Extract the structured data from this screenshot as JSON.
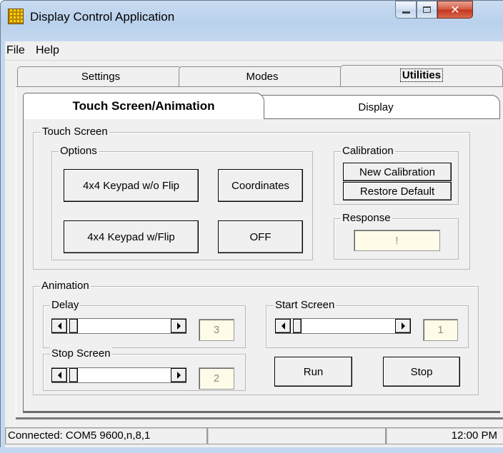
{
  "window": {
    "title": "Display Control Application",
    "icon": "keypad-grid-icon"
  },
  "menu": [
    "File",
    "Help"
  ],
  "outer_tabs": [
    {
      "label": "Settings",
      "active": false
    },
    {
      "label": "Modes",
      "active": false
    },
    {
      "label": "Utilities",
      "active": true
    }
  ],
  "inner_tabs": [
    {
      "label": "Touch Screen/Animation",
      "active": true
    },
    {
      "label": "Display",
      "active": false
    }
  ],
  "touch_screen": {
    "title": "Touch Screen",
    "options": {
      "title": "Options",
      "keypad_no_flip": "4x4 Keypad w/o Flip",
      "coordinates": "Coordinates",
      "keypad_flip": "4x4 Keypad w/Flip",
      "off": "OFF"
    },
    "calibration": {
      "title": "Calibration",
      "new": "New Calibration",
      "restore": "Restore Default"
    },
    "response": {
      "title": "Response",
      "value": "!"
    }
  },
  "animation": {
    "title": "Animation",
    "delay": {
      "title": "Delay",
      "value": "3"
    },
    "start_screen": {
      "title": "Start Screen",
      "value": "1"
    },
    "stop_screen": {
      "title": "Stop Screen",
      "value": "2"
    },
    "run": "Run",
    "stop": "Stop"
  },
  "status": {
    "connection": "Connected: COM5 9600,n,8,1",
    "middle": "",
    "time": "12:00 PM"
  },
  "colors": {
    "titlebar": "#c9dcf1",
    "face": "#f0f0f0",
    "readout_bg": "#fefce8",
    "close_red": "#c1341c"
  }
}
